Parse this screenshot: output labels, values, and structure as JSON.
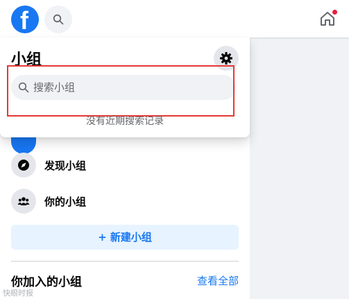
{
  "topbar": {
    "logo_letter": "f",
    "accent_color": "#1877f2",
    "icons": [
      "facebook-logo",
      "search-icon",
      "home-icon"
    ]
  },
  "dropdown": {
    "title": "小组",
    "search_placeholder": "搜索小组",
    "search_value": "",
    "empty_text": "没有近期搜索记录"
  },
  "sidebar": {
    "items": [
      {
        "label": "发现小组",
        "icon": "compass-icon"
      },
      {
        "label": "你的小组",
        "icon": "people-icon"
      }
    ],
    "new_group_label": "+ 新建小组",
    "joined_title": "你加入的小组",
    "see_all_label": "查看全部"
  },
  "watermark": "快眼时报"
}
